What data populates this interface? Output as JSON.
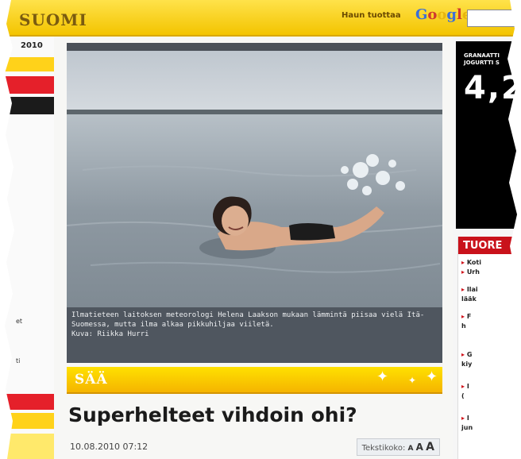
{
  "header": {
    "brand": "SUOMI",
    "search_label": "Haun tuottaa",
    "search_engine": "Google",
    "search_value": ""
  },
  "left_sidebar": {
    "date": "2010",
    "text_1": "et",
    "text_2": "ti"
  },
  "photo": {
    "caption": "Ilmatieteen laitoksen meteorologi Helena Laakson mukaan lämmintä piisaa vielä Itä-Suomessa, mutta ilma alkaa pikkuhiljaa viiletä.",
    "credit": "Kuva: Riikka Hurri"
  },
  "section": {
    "label": "SÄÄ"
  },
  "article": {
    "headline": "Superhelteet vihdoin ohi?",
    "timestamp": "10.08.2010 07:12",
    "textsize_label": "Tekstikoko:",
    "textsize_small": "A",
    "textsize_medium": "A",
    "textsize_large": "A"
  },
  "right_sidebar": {
    "ad_title": "GRANAATTI JOGURTTI S",
    "ad_price": "4,2",
    "latest_title": "TUORE",
    "latest_items": [
      "Koti",
      "Urh",
      "Ilai",
      "lääk",
      "F",
      "h",
      "G",
      "kiy",
      "I",
      "(",
      "I",
      "jun"
    ]
  },
  "colors": {
    "header_yellow": "#f3c400",
    "accent_red": "#c9121b",
    "section_yellow": "#ffe100"
  }
}
